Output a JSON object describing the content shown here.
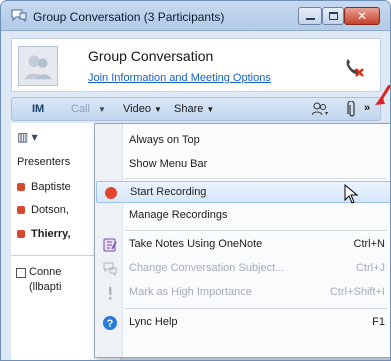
{
  "window": {
    "title": "Group Conversation (3 Participants)"
  },
  "header": {
    "title": "Group Conversation",
    "join_link": "Join Information and Meeting Options"
  },
  "toolbar": {
    "im": "IM",
    "call": "Call",
    "video": "Video",
    "share": "Share",
    "more": "»"
  },
  "roster": {
    "presenters_label": "Presenters",
    "participants": [
      "Baptiste",
      "Dotson,",
      "Thierry,"
    ],
    "connect_line1": "Conne",
    "connect_line2": "(llbapti"
  },
  "menu": {
    "items": [
      {
        "label": "Always on Top",
        "shortcut": ""
      },
      {
        "label": "Show Menu Bar",
        "shortcut": ""
      },
      {
        "label": "Start Recording",
        "shortcut": ""
      },
      {
        "label": "Manage Recordings",
        "shortcut": ""
      },
      {
        "label": "Take Notes Using OneNote",
        "shortcut": "Ctrl+N"
      },
      {
        "label": "Change Conversation Subject...",
        "shortcut": "Ctrl+J"
      },
      {
        "label": "Mark as High Importance",
        "shortcut": "Ctrl+Shift+I"
      },
      {
        "label": "Lync Help",
        "shortcut": "F1"
      }
    ]
  },
  "colors": {
    "accent": "#1560c8",
    "record_red": "#e0452b",
    "hover_bg": "#d7e7fa"
  }
}
